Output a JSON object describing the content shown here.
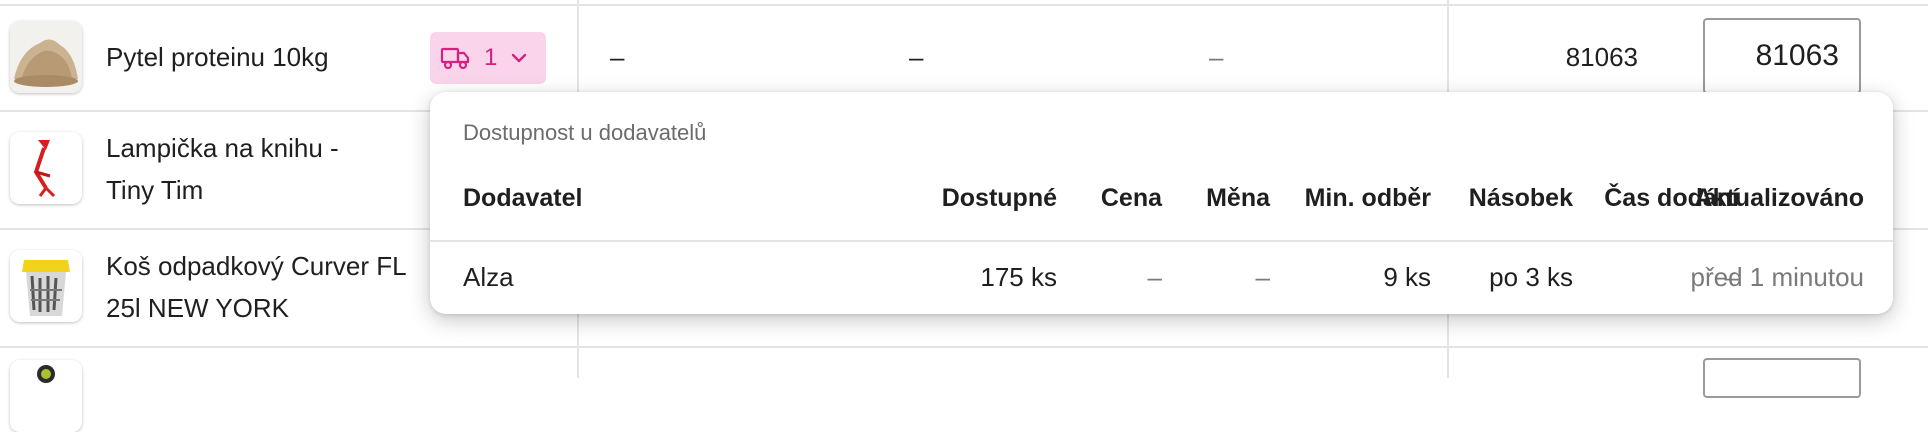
{
  "products": [
    {
      "name": "Pytel proteinu 10kg"
    },
    {
      "name_line1": "Lampička na knihu -",
      "name_line2": "Tiny Tim"
    },
    {
      "name_line1": "Koš odpadkový Curver FL",
      "name_line2": "25l NEW YORK"
    }
  ],
  "row1": {
    "supplier_count": "1",
    "dash_1": "–",
    "dash_2": "–",
    "dash_3": "–",
    "stock": "81063",
    "qty_value": "81063"
  },
  "popover": {
    "title": "Dostupnost u dodavatelů",
    "headers": {
      "supplier": "Dodavatel",
      "available": "Dostupné",
      "price": "Cena",
      "currency": "Měna",
      "min_order": "Min. odběr",
      "multiple": "Násobek",
      "delivery_time": "Čas dodání",
      "updated": "Aktualizováno"
    },
    "rows": [
      {
        "supplier": "Alza",
        "available": "175 ks",
        "price": "–",
        "currency": "–",
        "min_order": "9 ks",
        "multiple": "po 3 ks",
        "delivery_time": "–",
        "updated": "před 1 minutou"
      }
    ]
  },
  "icons": {
    "supplier_badge": "truck-icon",
    "supplier_toggle": "chevron-down-icon"
  },
  "colors": {
    "badge_bg": "#fad4ea",
    "badge_fg": "#d1237f",
    "grid_line": "#e4e4e4",
    "muted_text": "#7a7a7a"
  }
}
